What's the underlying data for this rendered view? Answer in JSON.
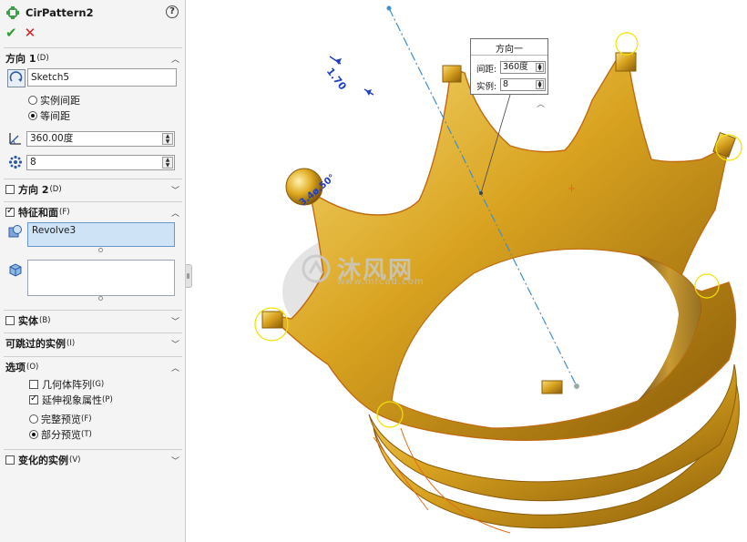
{
  "panel": {
    "title": "CirPattern2",
    "help": "?",
    "ok": "✔",
    "cancel": "✕",
    "direction1": {
      "label": "方向 1",
      "shortcut": "(D)",
      "sketch": "Sketch5",
      "options": [
        "实例间距",
        "等间距"
      ],
      "selected": "等间距",
      "angle": "360.00度",
      "count": "8"
    },
    "direction2": {
      "label": "方向 2",
      "shortcut": "(D)",
      "checked": false
    },
    "features": {
      "label": "特征和面",
      "shortcut": "(F)",
      "checked": true,
      "items": [
        "Revolve3"
      ]
    },
    "bodies": {
      "label": "实体",
      "shortcut": "(B)",
      "checked": false
    },
    "skip": {
      "label": "可跳过的实例",
      "shortcut": "(I)"
    },
    "options": {
      "label": "选项",
      "shortcut": "(O)",
      "geometry_pattern": "几何体阵列",
      "geometry_pattern_key": "(G)",
      "geometry_pattern_checked": false,
      "propagate_visual": "延伸视象属性",
      "propagate_visual_key": "(P)",
      "propagate_visual_checked": true,
      "full_preview": "完整预览",
      "full_preview_key": "(F)",
      "partial_preview": "部分预览",
      "partial_preview_key": "(T)",
      "preview_selected": "部分预览"
    },
    "varied": {
      "label": "变化的实例",
      "shortcut": "(V)",
      "checked": false
    }
  },
  "popup": {
    "title": "方向一",
    "spacing_label": "间距:",
    "spacing_value": "360度",
    "instances_label": "实例:",
    "instances_value": "8"
  },
  "viewport": {
    "dimension": "1.70",
    "dimension2": "3.4ø.50°",
    "watermark": "沐风网",
    "watermark_url": "www.mfcad.com"
  },
  "colors": {
    "accent_blue": "#1f3fbf",
    "gold": "#d7a21c",
    "axis": "#3d8fd1"
  }
}
